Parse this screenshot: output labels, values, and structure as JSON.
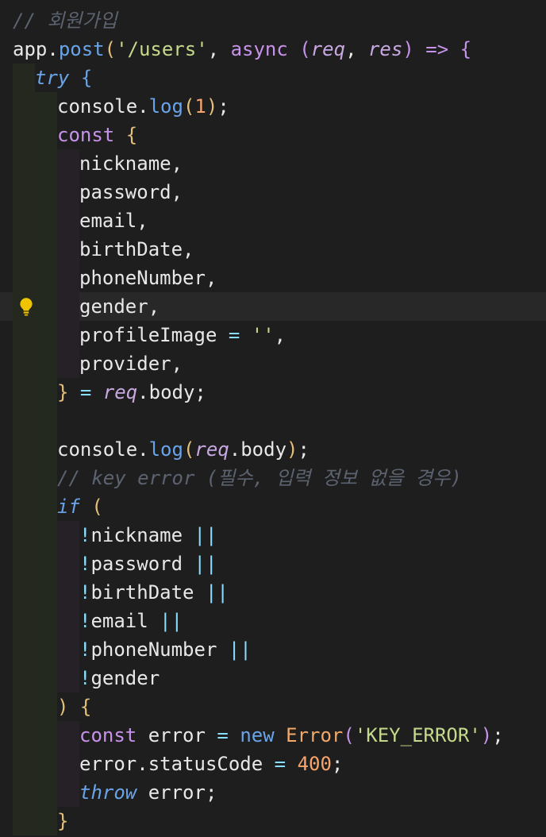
{
  "editor": {
    "language": "javascript",
    "theme_colors": {
      "background": "#1e1e1e",
      "current_line": "#282828",
      "comment": "#5c6370",
      "function": "#6aa4e8",
      "string": "#c5d98c",
      "keyword": "#c792ea",
      "number": "#f7a56b",
      "bracket_gold": "#e5c07b"
    },
    "lightbulb_icon_line": 10,
    "lines": [
      {
        "indent": 0,
        "tokens": [
          {
            "t": "// 회원가입",
            "c": "cm"
          }
        ]
      },
      {
        "indent": 0,
        "tokens": [
          {
            "t": "app",
            "c": "id"
          },
          {
            "t": ".",
            "c": "id"
          },
          {
            "t": "post",
            "c": "fn"
          },
          {
            "t": "(",
            "c": "pb1"
          },
          {
            "t": "'/users'",
            "c": "str"
          },
          {
            "t": ", ",
            "c": "id"
          },
          {
            "t": "async",
            "c": "kw"
          },
          {
            "t": " ",
            "c": "id"
          },
          {
            "t": "(",
            "c": "pb2"
          },
          {
            "t": "req",
            "c": "par"
          },
          {
            "t": ", ",
            "c": "id"
          },
          {
            "t": "res",
            "c": "par"
          },
          {
            "t": ")",
            "c": "pb2"
          },
          {
            "t": " ",
            "c": "id"
          },
          {
            "t": "=>",
            "c": "kw"
          },
          {
            "t": " ",
            "c": "id"
          },
          {
            "t": "{",
            "c": "pb2"
          }
        ]
      },
      {
        "indent": 1,
        "tokens": [
          {
            "t": "try",
            "c": "kwi"
          },
          {
            "t": " ",
            "c": "id"
          },
          {
            "t": "{",
            "c": "pb3"
          }
        ]
      },
      {
        "indent": 2,
        "tokens": [
          {
            "t": "console",
            "c": "id"
          },
          {
            "t": ".",
            "c": "id"
          },
          {
            "t": "log",
            "c": "fn"
          },
          {
            "t": "(",
            "c": "pb1"
          },
          {
            "t": "1",
            "c": "num"
          },
          {
            "t": ")",
            "c": "pb1"
          },
          {
            "t": ";",
            "c": "id"
          }
        ]
      },
      {
        "indent": 2,
        "tokens": [
          {
            "t": "const",
            "c": "kw"
          },
          {
            "t": " ",
            "c": "id"
          },
          {
            "t": "{",
            "c": "pb1"
          }
        ]
      },
      {
        "indent": 3,
        "tokens": [
          {
            "t": "nickname,",
            "c": "id"
          }
        ]
      },
      {
        "indent": 3,
        "tokens": [
          {
            "t": "password,",
            "c": "id"
          }
        ]
      },
      {
        "indent": 3,
        "tokens": [
          {
            "t": "email,",
            "c": "id"
          }
        ]
      },
      {
        "indent": 3,
        "tokens": [
          {
            "t": "birthDate,",
            "c": "id"
          }
        ]
      },
      {
        "indent": 3,
        "tokens": [
          {
            "t": "phoneNumber,",
            "c": "id"
          }
        ]
      },
      {
        "indent": 3,
        "current": true,
        "tokens": [
          {
            "t": "gender,",
            "c": "id"
          }
        ]
      },
      {
        "indent": 3,
        "tokens": [
          {
            "t": "profileImage",
            "c": "id"
          },
          {
            "t": " ",
            "c": "id"
          },
          {
            "t": "=",
            "c": "op"
          },
          {
            "t": " ",
            "c": "id"
          },
          {
            "t": "''",
            "c": "str"
          },
          {
            "t": ",",
            "c": "id"
          }
        ]
      },
      {
        "indent": 3,
        "tokens": [
          {
            "t": "provider,",
            "c": "id"
          }
        ]
      },
      {
        "indent": 2,
        "tokens": [
          {
            "t": "}",
            "c": "pb1"
          },
          {
            "t": " ",
            "c": "id"
          },
          {
            "t": "=",
            "c": "op"
          },
          {
            "t": " ",
            "c": "id"
          },
          {
            "t": "req",
            "c": "par"
          },
          {
            "t": ".",
            "c": "id"
          },
          {
            "t": "body",
            "c": "id"
          },
          {
            "t": ";",
            "c": "id"
          }
        ]
      },
      {
        "indent": 2,
        "blank": true,
        "tokens": []
      },
      {
        "indent": 2,
        "tokens": [
          {
            "t": "console",
            "c": "id"
          },
          {
            "t": ".",
            "c": "id"
          },
          {
            "t": "log",
            "c": "fn"
          },
          {
            "t": "(",
            "c": "pb1"
          },
          {
            "t": "req",
            "c": "par"
          },
          {
            "t": ".",
            "c": "id"
          },
          {
            "t": "body",
            "c": "id"
          },
          {
            "t": ")",
            "c": "pb1"
          },
          {
            "t": ";",
            "c": "id"
          }
        ]
      },
      {
        "indent": 2,
        "tokens": [
          {
            "t": "// key error (필수, 입력 정보 없을 경우)",
            "c": "cm"
          }
        ]
      },
      {
        "indent": 2,
        "tokens": [
          {
            "t": "if",
            "c": "kwi"
          },
          {
            "t": " ",
            "c": "id"
          },
          {
            "t": "(",
            "c": "pb1"
          }
        ]
      },
      {
        "indent": 3,
        "tokens": [
          {
            "t": "!",
            "c": "op"
          },
          {
            "t": "nickname",
            "c": "id"
          },
          {
            "t": " ",
            "c": "id"
          },
          {
            "t": "||",
            "c": "op"
          }
        ]
      },
      {
        "indent": 3,
        "tokens": [
          {
            "t": "!",
            "c": "op"
          },
          {
            "t": "password",
            "c": "id"
          },
          {
            "t": " ",
            "c": "id"
          },
          {
            "t": "||",
            "c": "op"
          }
        ]
      },
      {
        "indent": 3,
        "tokens": [
          {
            "t": "!",
            "c": "op"
          },
          {
            "t": "birthDate",
            "c": "id"
          },
          {
            "t": " ",
            "c": "id"
          },
          {
            "t": "||",
            "c": "op"
          }
        ]
      },
      {
        "indent": 3,
        "tokens": [
          {
            "t": "!",
            "c": "op"
          },
          {
            "t": "email",
            "c": "id"
          },
          {
            "t": " ",
            "c": "id"
          },
          {
            "t": "||",
            "c": "op"
          }
        ]
      },
      {
        "indent": 3,
        "tokens": [
          {
            "t": "!",
            "c": "op"
          },
          {
            "t": "phoneNumber",
            "c": "id"
          },
          {
            "t": " ",
            "c": "id"
          },
          {
            "t": "||",
            "c": "op"
          }
        ]
      },
      {
        "indent": 3,
        "tokens": [
          {
            "t": "!",
            "c": "op"
          },
          {
            "t": "gender",
            "c": "id"
          }
        ]
      },
      {
        "indent": 2,
        "tokens": [
          {
            "t": ")",
            "c": "pb1"
          },
          {
            "t": " ",
            "c": "id"
          },
          {
            "t": "{",
            "c": "pb1"
          }
        ]
      },
      {
        "indent": 3,
        "tokens": [
          {
            "t": "const",
            "c": "kw"
          },
          {
            "t": " ",
            "c": "id"
          },
          {
            "t": "error",
            "c": "id"
          },
          {
            "t": " ",
            "c": "id"
          },
          {
            "t": "=",
            "c": "op"
          },
          {
            "t": " ",
            "c": "id"
          },
          {
            "t": "new",
            "c": "fn"
          },
          {
            "t": " ",
            "c": "id"
          },
          {
            "t": "Error",
            "c": "cls"
          },
          {
            "t": "(",
            "c": "pb2"
          },
          {
            "t": "'KEY_ERROR'",
            "c": "str"
          },
          {
            "t": ")",
            "c": "pb2"
          },
          {
            "t": ";",
            "c": "id"
          }
        ]
      },
      {
        "indent": 3,
        "tokens": [
          {
            "t": "error",
            "c": "id"
          },
          {
            "t": ".",
            "c": "id"
          },
          {
            "t": "statusCode",
            "c": "id"
          },
          {
            "t": " ",
            "c": "id"
          },
          {
            "t": "=",
            "c": "op"
          },
          {
            "t": " ",
            "c": "id"
          },
          {
            "t": "400",
            "c": "num"
          },
          {
            "t": ";",
            "c": "id"
          }
        ]
      },
      {
        "indent": 3,
        "tokens": [
          {
            "t": "throw",
            "c": "kwi"
          },
          {
            "t": " ",
            "c": "id"
          },
          {
            "t": "error",
            "c": "id"
          },
          {
            "t": ";",
            "c": "id"
          }
        ]
      },
      {
        "indent": 2,
        "tokens": [
          {
            "t": "}",
            "c": "pb1"
          }
        ]
      }
    ]
  }
}
